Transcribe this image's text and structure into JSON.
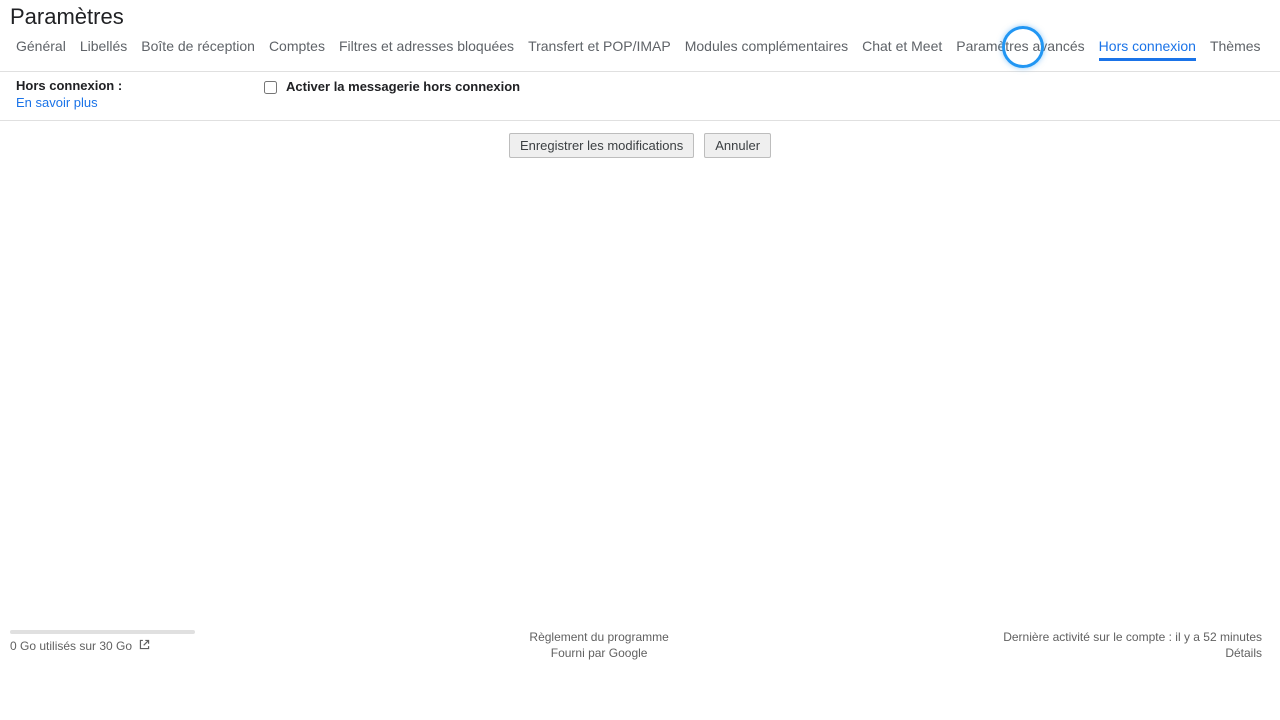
{
  "page_title": "Paramètres",
  "tabs": [
    {
      "label": "Général"
    },
    {
      "label": "Libellés"
    },
    {
      "label": "Boîte de réception"
    },
    {
      "label": "Comptes"
    },
    {
      "label": "Filtres et adresses bloquées"
    },
    {
      "label": "Transfert et POP/IMAP"
    },
    {
      "label": "Modules complémentaires"
    },
    {
      "label": "Chat et Meet"
    },
    {
      "label": "Paramètres avancés"
    },
    {
      "label": "Hors connexion",
      "active": true
    },
    {
      "label": "Thèmes"
    }
  ],
  "section": {
    "label": "Hors connexion :",
    "learn_more": "En savoir plus",
    "checkbox_label": "Activer la messagerie hors connexion"
  },
  "buttons": {
    "save": "Enregistrer les modifications",
    "cancel": "Annuler"
  },
  "footer": {
    "storage_text": "0 Go utilisés sur 30 Go",
    "program_rules": "Règlement du programme",
    "powered_by": "Fourni par Google",
    "last_activity": "Dernière activité sur le compte : il y a 52 minutes",
    "details": "Détails"
  }
}
